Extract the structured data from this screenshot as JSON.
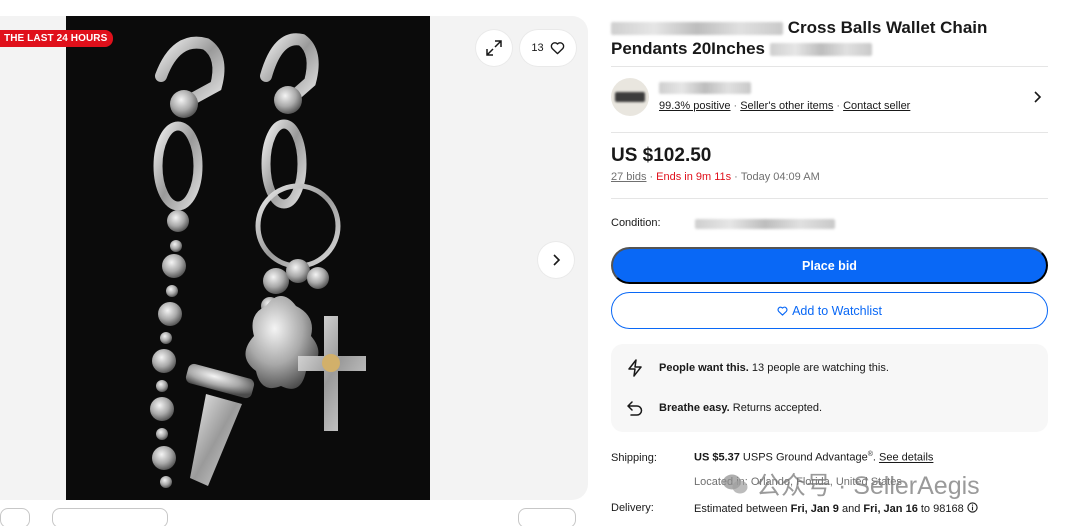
{
  "gallery": {
    "badge": "THE LAST 24 HOURS",
    "watch_count": "13",
    "icons": [
      "expand-icon",
      "heart-icon",
      "chevron-right-icon"
    ]
  },
  "listing": {
    "title_visible": "Cross Balls Wallet Chain",
    "title_line2": "Pendants 20Inches"
  },
  "seller": {
    "feedback": "99.3% positive",
    "other_items": "Seller's other items",
    "contact": "Contact seller",
    "separator": "·"
  },
  "price": {
    "amount": "US $102.50",
    "bids": "27 bids",
    "ends": "Ends in 9m 11s",
    "end_time": "Today 04:09 AM",
    "separator": "·"
  },
  "condition": {
    "label": "Condition:"
  },
  "buttons": {
    "place_bid": "Place bid",
    "watchlist": "Add to Watchlist"
  },
  "highlights": [
    {
      "icon": "lightning-icon",
      "bold": "People want this.",
      "text": " 13 people are watching this."
    },
    {
      "icon": "return-arrow-icon",
      "bold": "Breathe easy.",
      "text": " Returns accepted."
    }
  ],
  "shipping": {
    "label": "Shipping:",
    "cost": "US $5.37",
    "service": " USPS Ground Advantage",
    "service_mark": "®",
    "details_link": "See details",
    "location": "Located in: Orlando, Florida, United States"
  },
  "delivery": {
    "label": "Delivery:",
    "prefix": "Estimated between ",
    "date1": "Fri, Jan 9",
    "and": " and ",
    "date2": "Fri, Jan 16",
    "suffix": " to 98168 "
  },
  "watermark": {
    "text": "公众号 · SellerAegis"
  },
  "colors": {
    "accent_blue": "#0968f6",
    "alert_red": "#e0101b",
    "text_primary": "#191919",
    "text_secondary": "#707070"
  }
}
